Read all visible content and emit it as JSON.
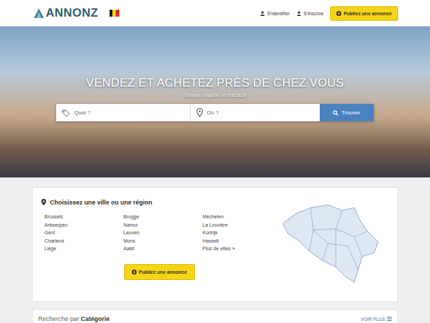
{
  "header": {
    "logo": "ANNONZ",
    "login": "S'identifier",
    "register": "S'inscrire",
    "publish": "Publiez une annonce"
  },
  "hero": {
    "title": "VENDEZ ET ACHETEZ PRÈS DE CHEZ VOUS",
    "subtitle": "Simple, rapide et efficace",
    "search": {
      "what_placeholder": "Quoi ?",
      "where_placeholder": "Où ?",
      "button": "Trouver"
    }
  },
  "cities": {
    "title": "Choisissez une ville ou une région",
    "columns": [
      [
        "Brussels",
        "Antwerpen",
        "Gent",
        "Charleroi",
        "Liège"
      ],
      [
        "Brugge",
        "Namur",
        "Leuven",
        "Mons",
        "Aalst"
      ],
      [
        "Mechelen",
        "La Louvière",
        "Kortrijk",
        "Hasselt",
        "Plus de villes »"
      ]
    ],
    "publish": "Publiez une annonce"
  },
  "categories": {
    "title_prefix": "Recherche par",
    "title": "Catégorie",
    "more": "VOIR PLUS"
  }
}
